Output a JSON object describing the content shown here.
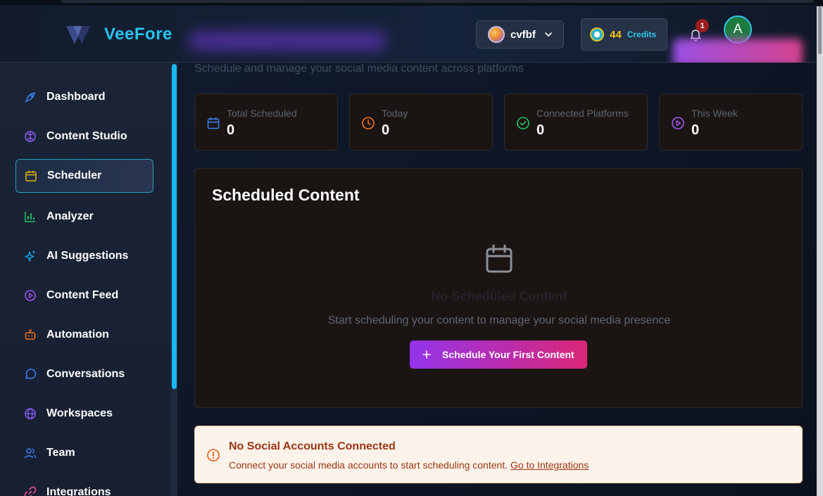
{
  "app": {
    "brand": "VeeFore"
  },
  "header": {
    "workspace_name": "cvfbf",
    "credits_value": "44",
    "credits_label": "Credits",
    "notifications_count": "1",
    "user_initial": "A"
  },
  "sidebar": {
    "items": [
      {
        "label": "Dashboard",
        "icon": "rocket-icon",
        "color": "#3b82f6"
      },
      {
        "label": "Content Studio",
        "icon": "globe-brain-icon",
        "color": "#8b5cf6"
      },
      {
        "label": "Scheduler",
        "icon": "calendar-icon",
        "color": "#eab308",
        "active": true
      },
      {
        "label": "Analyzer",
        "icon": "bar-chart-icon",
        "color": "#22c55e"
      },
      {
        "label": "AI Suggestions",
        "icon": "sparkles-icon",
        "color": "#0ea5e9"
      },
      {
        "label": "Content Feed",
        "icon": "play-circle-icon",
        "color": "#a855f7"
      },
      {
        "label": "Automation",
        "icon": "bot-icon",
        "color": "#f97316"
      },
      {
        "label": "Conversations",
        "icon": "chat-bubble-icon",
        "color": "#3b82f6"
      },
      {
        "label": "Workspaces",
        "icon": "globe-icon",
        "color": "#8b5cf6"
      },
      {
        "label": "Team",
        "icon": "users-icon",
        "color": "#3b82f6"
      },
      {
        "label": "Integrations",
        "icon": "link-icon",
        "color": "#ec4899"
      }
    ]
  },
  "main": {
    "subtitle": "Schedule and manage your social media content across platforms",
    "stats": [
      {
        "label": "Total Scheduled",
        "value": "0",
        "icon": "calendar-icon",
        "color": "#3b82f6"
      },
      {
        "label": "Today",
        "value": "0",
        "icon": "clock-icon",
        "color": "#f97316"
      },
      {
        "label": "Connected Platforms",
        "value": "0",
        "icon": "check-circle-icon",
        "color": "#22c55e"
      },
      {
        "label": "This Week",
        "value": "0",
        "icon": "play-circle-icon",
        "color": "#a855f7"
      }
    ],
    "panel": {
      "title": "Scheduled Content",
      "empty_title": "No Scheduled Content",
      "empty_text": "Start scheduling your content to manage your social media presence",
      "cta_label": "Schedule Your First Content"
    },
    "alert": {
      "title": "No Social Accounts Connected",
      "text": "Connect your social media accounts to start scheduling content.",
      "link_label": "Go to Integrations"
    }
  }
}
